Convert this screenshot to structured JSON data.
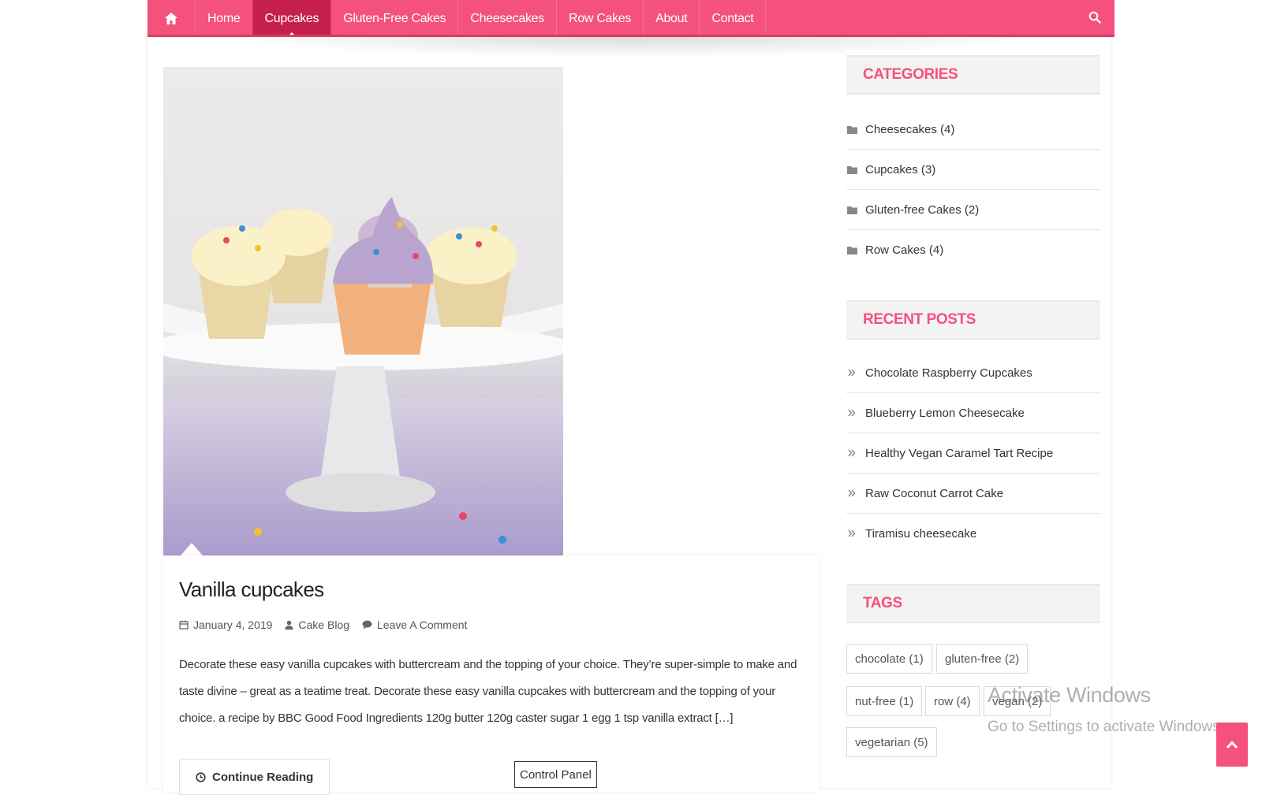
{
  "nav": {
    "home_icon": "home-icon",
    "items": [
      {
        "label": "Home",
        "active": false
      },
      {
        "label": "Cupcakes",
        "active": true
      },
      {
        "label": "Gluten-Free Cakes",
        "active": false
      },
      {
        "label": "Cheesecakes",
        "active": false
      },
      {
        "label": "Row Cakes",
        "active": false
      },
      {
        "label": "About",
        "active": false
      },
      {
        "label": "Contact",
        "active": false
      }
    ],
    "search_icon": "search-icon"
  },
  "colors": {
    "accent": "#f4517d",
    "accent_dark": "#c5204d"
  },
  "post": {
    "title": "Vanilla cupcakes",
    "date": "January 4, 2019",
    "author": "Cake Blog",
    "comments": "Leave A Comment",
    "excerpt": "Decorate these easy vanilla cupcakes with buttercream and the topping of your choice. They’re super-simple to make and taste divine – great as a teatime treat. Decorate these easy vanilla cupcakes with buttercream and the topping of your choice. a recipe by BBC Good Food Ingredients 120g butter 120g caster sugar 1 egg 1 tsp vanilla extract […]",
    "continue_label": "Continue Reading"
  },
  "sidebar": {
    "categories": {
      "title": "CATEGORIES",
      "items": [
        "Cheesecakes (4)",
        "Cupcakes (3)",
        "Gluten-free Cakes (2)",
        "Row Cakes (4)"
      ]
    },
    "recent_posts": {
      "title": "RECENT POSTS",
      "items": [
        "Chocolate Raspberry Cupcakes",
        "Blueberry Lemon Cheesecake",
        "Healthy Vegan Caramel Tart Recipe",
        "Raw Coconut Carrot Cake",
        "Tiramisu cheesecake"
      ]
    },
    "tags": {
      "title": "TAGS",
      "items": [
        "chocolate (1)",
        "gluten-free (2)",
        "nut-free (1)",
        "row (4)",
        "vegan (2)",
        "vegetarian (5)"
      ]
    }
  },
  "overlay": {
    "activate_title": "Activate Windows",
    "activate_sub": "Go to Settings to activate Windows.",
    "control_panel": "Control Panel"
  }
}
